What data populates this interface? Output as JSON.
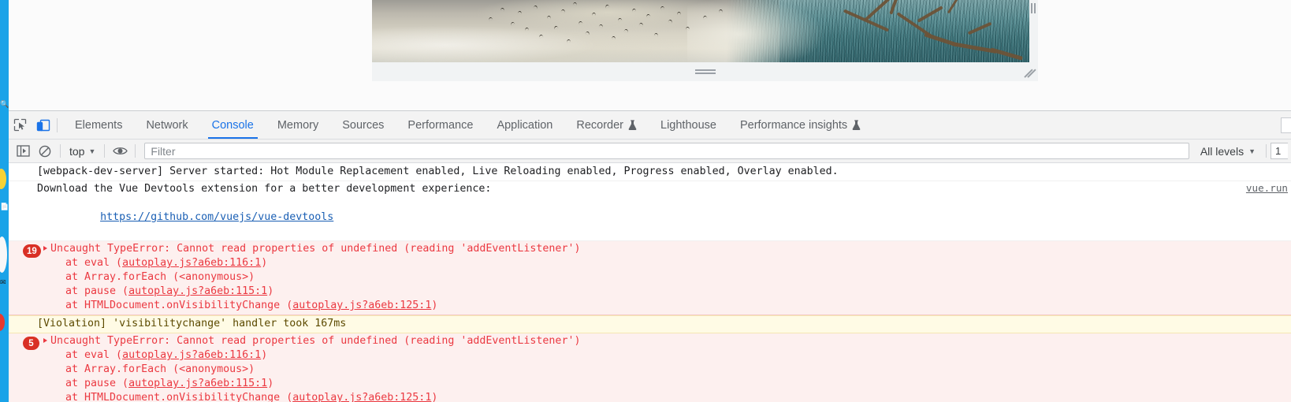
{
  "window": {
    "left_strip_color": "#1aa3e8"
  },
  "page": {
    "photo_alt": "deer-and-birds-winter-forest-photo",
    "drag_handle": "horizontal-drag-handle",
    "vertical_handle": "vertical-drag-handle",
    "resize_grip": "corner-resize-grip"
  },
  "devtools": {
    "toolbar_icons": [
      {
        "name": "inspect-element-icon",
        "title": "Inspect element"
      },
      {
        "name": "device-toolbar-icon",
        "title": "Toggle device toolbar"
      }
    ],
    "tabs": [
      {
        "label": "Elements",
        "active": false,
        "experimental": false
      },
      {
        "label": "Network",
        "active": false,
        "experimental": false
      },
      {
        "label": "Console",
        "active": true,
        "experimental": false
      },
      {
        "label": "Memory",
        "active": false,
        "experimental": false
      },
      {
        "label": "Sources",
        "active": false,
        "experimental": false
      },
      {
        "label": "Performance",
        "active": false,
        "experimental": false
      },
      {
        "label": "Application",
        "active": false,
        "experimental": false
      },
      {
        "label": "Recorder",
        "active": false,
        "experimental": true
      },
      {
        "label": "Lighthouse",
        "active": false,
        "experimental": false
      },
      {
        "label": "Performance insights",
        "active": false,
        "experimental": true
      }
    ],
    "active_tab_color": "#1a73e8"
  },
  "console_toolbar": {
    "sidebar_toggle": "console-sidebar-toggle-icon",
    "clear_console": "clear-console-icon",
    "context_selector": "top",
    "live_expression": "eye-icon",
    "filter_placeholder": "Filter",
    "filter_value": "",
    "levels_label": "All levels",
    "settings_partial": "1"
  },
  "console_messages": [
    {
      "type": "log",
      "lines": [
        "[webpack-dev-server] Server started: Hot Module Replacement enabled, Live Reloading enabled, Progress enabled, Overlay enabled."
      ],
      "source": ""
    },
    {
      "type": "log",
      "lines": [
        "Download the Vue Devtools extension for a better development experience:",
        "https://github.com/vuejs/vue-devtools"
      ],
      "link_line_index": 1,
      "source": "vue.run"
    },
    {
      "type": "error",
      "badge": "19",
      "head": "Uncaught TypeError: Cannot read properties of undefined (reading 'addEventListener')",
      "stack": [
        {
          "text": "at eval (",
          "link": "autoplay.js?a6eb:116:1",
          "tail": ")"
        },
        {
          "text": "at Array.forEach (<anonymous>)",
          "link": "",
          "tail": ""
        },
        {
          "text": "at pause (",
          "link": "autoplay.js?a6eb:115:1",
          "tail": ")"
        },
        {
          "text": "at HTMLDocument.onVisibilityChange (",
          "link": "autoplay.js?a6eb:125:1",
          "tail": ")"
        }
      ]
    },
    {
      "type": "warning",
      "lines": [
        "[Violation] 'visibilitychange' handler took 167ms"
      ]
    },
    {
      "type": "error",
      "badge": "5",
      "head": "Uncaught TypeError: Cannot read properties of undefined (reading 'addEventListener')",
      "stack": [
        {
          "text": "at eval (",
          "link": "autoplay.js?a6eb:116:1",
          "tail": ")"
        },
        {
          "text": "at Array.forEach (<anonymous>)",
          "link": "",
          "tail": ""
        },
        {
          "text": "at pause (",
          "link": "autoplay.js?a6eb:115:1",
          "tail": ")"
        },
        {
          "text": "at HTMLDocument.onVisibilityChange (",
          "link": "autoplay.js?a6eb:125:1",
          "tail": ")"
        }
      ]
    }
  ],
  "colors": {
    "error_text": "#eb3941",
    "error_bg": "#fdf0ef",
    "warning_bg": "#fffbe5",
    "badge_bg": "#d93025",
    "accent": "#1a73e8"
  }
}
